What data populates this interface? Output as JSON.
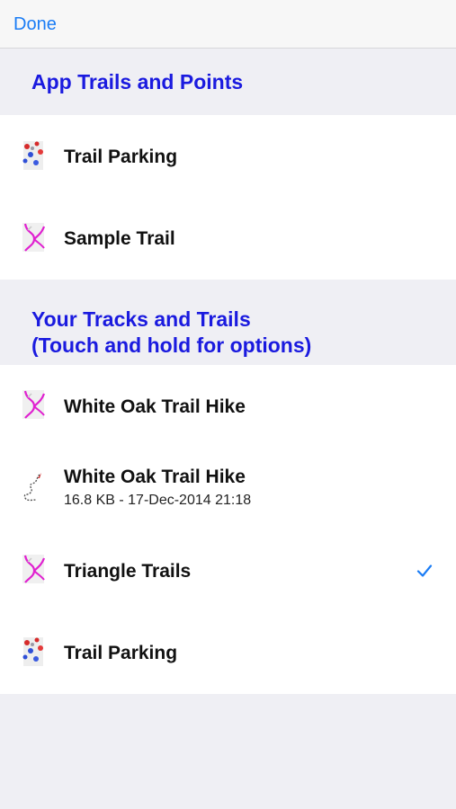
{
  "navbar": {
    "done_label": "Done"
  },
  "app_section": {
    "header": "App Trails and Points",
    "items": [
      {
        "title": "Trail Parking",
        "icon": "parking-points-icon"
      },
      {
        "title": "Sample Trail",
        "icon": "trail-map-icon"
      }
    ]
  },
  "your_section": {
    "header_line1": "Your Tracks and Trails",
    "header_line2": "(Touch and hold for options)",
    "items": [
      {
        "title": "White Oak Trail Hike",
        "icon": "trail-map-icon"
      },
      {
        "title": "White Oak Trail Hike",
        "subtitle": "16.8 KB - 17-Dec-2014 21:18",
        "icon": "gps-track-icon"
      },
      {
        "title": "Triangle Trails",
        "icon": "trail-map-icon",
        "selected": true
      },
      {
        "title": "Trail Parking",
        "icon": "parking-points-icon"
      }
    ]
  },
  "colors": {
    "accent": "#1a7cf5",
    "section_header": "#1a1adf",
    "background": "#efeff4",
    "trail_magenta": "#e020d0"
  }
}
